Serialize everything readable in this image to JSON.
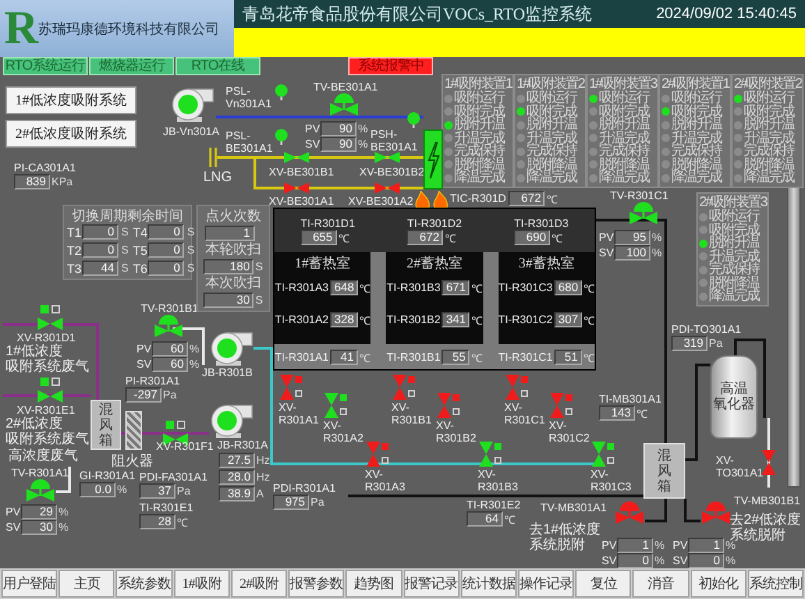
{
  "header": {
    "logo": "R",
    "company": "苏瑞玛康德环境科技有限公司",
    "title": "青岛花帝食品股份有限公司VOCs_RTO监控系统",
    "datetime": "2024/09/02 15:40:45"
  },
  "status_indicators": [
    {
      "label": "RTO系统运行",
      "kind": "running"
    },
    {
      "label": "燃烧器运行",
      "kind": "running"
    },
    {
      "label": "RTO在线",
      "kind": "running"
    },
    {
      "label": "系统报警中",
      "kind": "alarm"
    }
  ],
  "system_buttons": [
    "1#低浓度吸附系统",
    "2#低浓度吸附系统"
  ],
  "adsorbers": [
    {
      "title": "1#吸附装置1",
      "steps": [
        {
          "label": "吸附运行",
          "active": false
        },
        {
          "label": "吸附完成",
          "active": false
        },
        {
          "label": "脱附升温",
          "active": true
        },
        {
          "label": "升温完成",
          "active": false
        },
        {
          "label": "完成保持",
          "active": false
        },
        {
          "label": "脱附降温",
          "active": false
        },
        {
          "label": "降温完成",
          "active": false
        }
      ]
    },
    {
      "title": "1#吸附装置2",
      "steps": [
        {
          "label": "吸附运行",
          "active": false
        },
        {
          "label": "吸附完成",
          "active": true
        },
        {
          "label": "脱附升温",
          "active": false
        },
        {
          "label": "升温完成",
          "active": false
        },
        {
          "label": "完成保持",
          "active": false
        },
        {
          "label": "脱附降温",
          "active": false
        },
        {
          "label": "降温完成",
          "active": false
        }
      ]
    },
    {
      "title": "1#吸附装置3",
      "steps": [
        {
          "label": "吸附运行",
          "active": true
        },
        {
          "label": "吸附完成",
          "active": false
        },
        {
          "label": "脱附升温",
          "active": false
        },
        {
          "label": "升温完成",
          "active": false
        },
        {
          "label": "完成保持",
          "active": false
        },
        {
          "label": "脱附降温",
          "active": false
        },
        {
          "label": "降温完成",
          "active": false
        }
      ]
    },
    {
      "title": "2#吸附装置1",
      "steps": [
        {
          "label": "吸附运行",
          "active": false
        },
        {
          "label": "吸附完成",
          "active": true
        },
        {
          "label": "脱附升温",
          "active": false
        },
        {
          "label": "升温完成",
          "active": false
        },
        {
          "label": "完成保持",
          "active": false
        },
        {
          "label": "脱附降温",
          "active": false
        },
        {
          "label": "降温完成",
          "active": false
        }
      ]
    },
    {
      "title": "2#吸附装置2",
      "steps": [
        {
          "label": "吸附运行",
          "active": true
        },
        {
          "label": "吸附完成",
          "active": false
        },
        {
          "label": "脱附升温",
          "active": false
        },
        {
          "label": "升温完成",
          "active": false
        },
        {
          "label": "完成保持",
          "active": false
        },
        {
          "label": "脱附降温",
          "active": false
        },
        {
          "label": "降温完成",
          "active": false
        }
      ]
    },
    {
      "title": "2#吸附装置3",
      "steps": [
        {
          "label": "吸附运行",
          "active": false
        },
        {
          "label": "吸附完成",
          "active": false
        },
        {
          "label": "脱附升温",
          "active": true
        },
        {
          "label": "升温完成",
          "active": false
        },
        {
          "label": "完成保持",
          "active": false
        },
        {
          "label": "脱附降温",
          "active": false
        },
        {
          "label": "降温完成",
          "active": false
        }
      ]
    }
  ],
  "pressure_switches": [
    {
      "tag": "PSL-Vn301A1",
      "on": true
    },
    {
      "tag": "PSL-BE301A1",
      "on": true
    },
    {
      "tag": "PSH-BE301A1",
      "on": true
    }
  ],
  "fans": [
    {
      "tag": "JB-Vn301A",
      "running": true
    },
    {
      "tag": "JB-R301B",
      "running": true
    },
    {
      "tag": "JB-R301A",
      "running": true,
      "readings": [
        {
          "value": "27.5",
          "unit": "Hz"
        },
        {
          "value": "28.0",
          "unit": "Hz"
        },
        {
          "value": "38.9",
          "unit": "A"
        }
      ]
    }
  ],
  "control_valves": [
    {
      "tag": "TV-BE301A1",
      "open": true,
      "rows": [
        {
          "label": "PV",
          "value": "90",
          "unit": "%"
        },
        {
          "label": "SV",
          "value": "90",
          "unit": "%"
        }
      ]
    },
    {
      "tag": "TV-R301B1",
      "open": true,
      "rows": [
        {
          "label": "PV",
          "value": "60",
          "unit": "%"
        },
        {
          "label": "SV",
          "value": "60",
          "unit": "%"
        }
      ]
    },
    {
      "tag": "TV-R301C1",
      "open": true,
      "rows": [
        {
          "label": "PV",
          "value": "95",
          "unit": "%"
        },
        {
          "label": "SV",
          "value": "100",
          "unit": "%"
        }
      ]
    },
    {
      "tag": "TV-R301A1",
      "open": true,
      "rows": [
        {
          "label": "PV",
          "value": "29",
          "unit": "%"
        },
        {
          "label": "SV",
          "value": "30",
          "unit": "%"
        }
      ]
    },
    {
      "tag": "TV-MB301A1",
      "open": false,
      "rows": [
        {
          "label": "PV",
          "value": "1",
          "unit": "%"
        },
        {
          "label": "SV",
          "value": "0",
          "unit": "%"
        }
      ]
    },
    {
      "tag": "TV-MB301B1",
      "open": false,
      "rows": [
        {
          "label": "PV",
          "value": "1",
          "unit": "%"
        },
        {
          "label": "SV",
          "value": "0",
          "unit": "%"
        }
      ]
    }
  ],
  "on_off_valves": [
    {
      "tag": "XV-BE301B1",
      "open": true
    },
    {
      "tag": "XV-BE301B2",
      "open": true
    },
    {
      "tag": "XV-BE301A1",
      "open": false
    },
    {
      "tag": "XV-BE301A2",
      "open": false
    },
    {
      "tag": "XV-R301D1",
      "open": true
    },
    {
      "tag": "XV-R301E1",
      "open": true
    },
    {
      "tag": "XV-R301F1",
      "open": true
    },
    {
      "tag": "XV-R301A1",
      "open": false
    },
    {
      "tag": "XV-R301A2",
      "open": true
    },
    {
      "tag": "XV-R301A3",
      "open": false
    },
    {
      "tag": "XV-R301B1",
      "open": false
    },
    {
      "tag": "XV-R301B2",
      "open": false
    },
    {
      "tag": "XV-R301B3",
      "open": true
    },
    {
      "tag": "XV-R301C1",
      "open": false
    },
    {
      "tag": "XV-R301C2",
      "open": false
    },
    {
      "tag": "XV-R301C3",
      "open": true
    },
    {
      "tag": "XV-TO301A1",
      "open": false
    }
  ],
  "readings": [
    {
      "tag": "PI-CA301A1",
      "value": "839",
      "unit": "KPa"
    },
    {
      "tag": "TIC-R301D",
      "value": "672",
      "unit": "℃"
    },
    {
      "tag": "PDI-TO301A1",
      "value": "319",
      "unit": "Pa"
    },
    {
      "tag": "TI-MB301A1",
      "value": "143",
      "unit": "℃"
    },
    {
      "tag": "PI-R301A1",
      "value": "-297",
      "unit": "Pa"
    },
    {
      "tag": "GI-R301A1",
      "value": "0.0",
      "unit": "%"
    },
    {
      "tag": "PDI-FA301A1",
      "value": "37",
      "unit": "Pa"
    },
    {
      "tag": "TI-R301E1",
      "value": "28",
      "unit": "℃"
    },
    {
      "tag": "PDI-R301A1",
      "value": "975",
      "unit": "Pa"
    },
    {
      "tag": "TI-R301E2",
      "value": "64",
      "unit": "℃"
    }
  ],
  "switch_timer": {
    "title": "切换周期剩余时间",
    "timers": [
      {
        "name": "T1",
        "value": "0",
        "unit": "S"
      },
      {
        "name": "T4",
        "value": "0",
        "unit": "S"
      },
      {
        "name": "T2",
        "value": "0",
        "unit": "S"
      },
      {
        "name": "T5",
        "value": "0",
        "unit": "S"
      },
      {
        "name": "T3",
        "value": "44",
        "unit": "S"
      },
      {
        "name": "T6",
        "value": "0",
        "unit": "S"
      }
    ]
  },
  "ignition_panel": [
    {
      "label": "点火次数",
      "value": "1"
    },
    {
      "label": "本轮吹扫",
      "value": "180",
      "unit": "S"
    },
    {
      "label": "本次吹扫",
      "value": "30",
      "unit": "S"
    }
  ],
  "furnace": {
    "readings": [
      {
        "tag": "TI-R301D1",
        "value": "655",
        "unit": "℃"
      },
      {
        "tag": "TI-R301D2",
        "value": "672",
        "unit": "℃"
      },
      {
        "tag": "TI-R301D3",
        "value": "690",
        "unit": "℃"
      }
    ],
    "chambers": [
      {
        "title": "1#蓄热室",
        "readings": [
          {
            "tag": "TI-R301A3",
            "value": "648",
            "unit": "℃"
          },
          {
            "tag": "TI-R301A2",
            "value": "328",
            "unit": "℃"
          },
          {
            "tag": "TI-R301A1",
            "value": "41",
            "unit": "℃"
          }
        ]
      },
      {
        "title": "2#蓄热室",
        "readings": [
          {
            "tag": "TI-R301B3",
            "value": "671",
            "unit": "℃"
          },
          {
            "tag": "TI-R301B2",
            "value": "341",
            "unit": "℃"
          },
          {
            "tag": "TI-R301B1",
            "value": "55",
            "unit": "℃"
          }
        ]
      },
      {
        "title": "3#蓄热室",
        "readings": [
          {
            "tag": "TI-R301C3",
            "value": "680",
            "unit": "℃"
          },
          {
            "tag": "TI-R301C2",
            "value": "307",
            "unit": "℃"
          },
          {
            "tag": "TI-R301C1",
            "value": "51",
            "unit": "℃"
          }
        ]
      }
    ]
  },
  "mixers": [
    "混风箱",
    "混风箱"
  ],
  "oxidizer": [
    "高温",
    "氧化器"
  ],
  "notes": [
    "LNG",
    "1#低浓度",
    "吸附系统废气",
    "2#低浓度",
    "吸附系统废气",
    "高浓度废气",
    "阻火器",
    "去1#低浓度",
    "系统脱附",
    "去2#低浓度",
    "系统脱附"
  ],
  "nav": [
    "用户登陆",
    "主页",
    "系统参数",
    "1#吸附",
    "2#吸附",
    "报警参数",
    "趋势图",
    "报警记录",
    "统计数据",
    "操作记录",
    "复位",
    "消音",
    "初始化",
    "系统控制"
  ]
}
